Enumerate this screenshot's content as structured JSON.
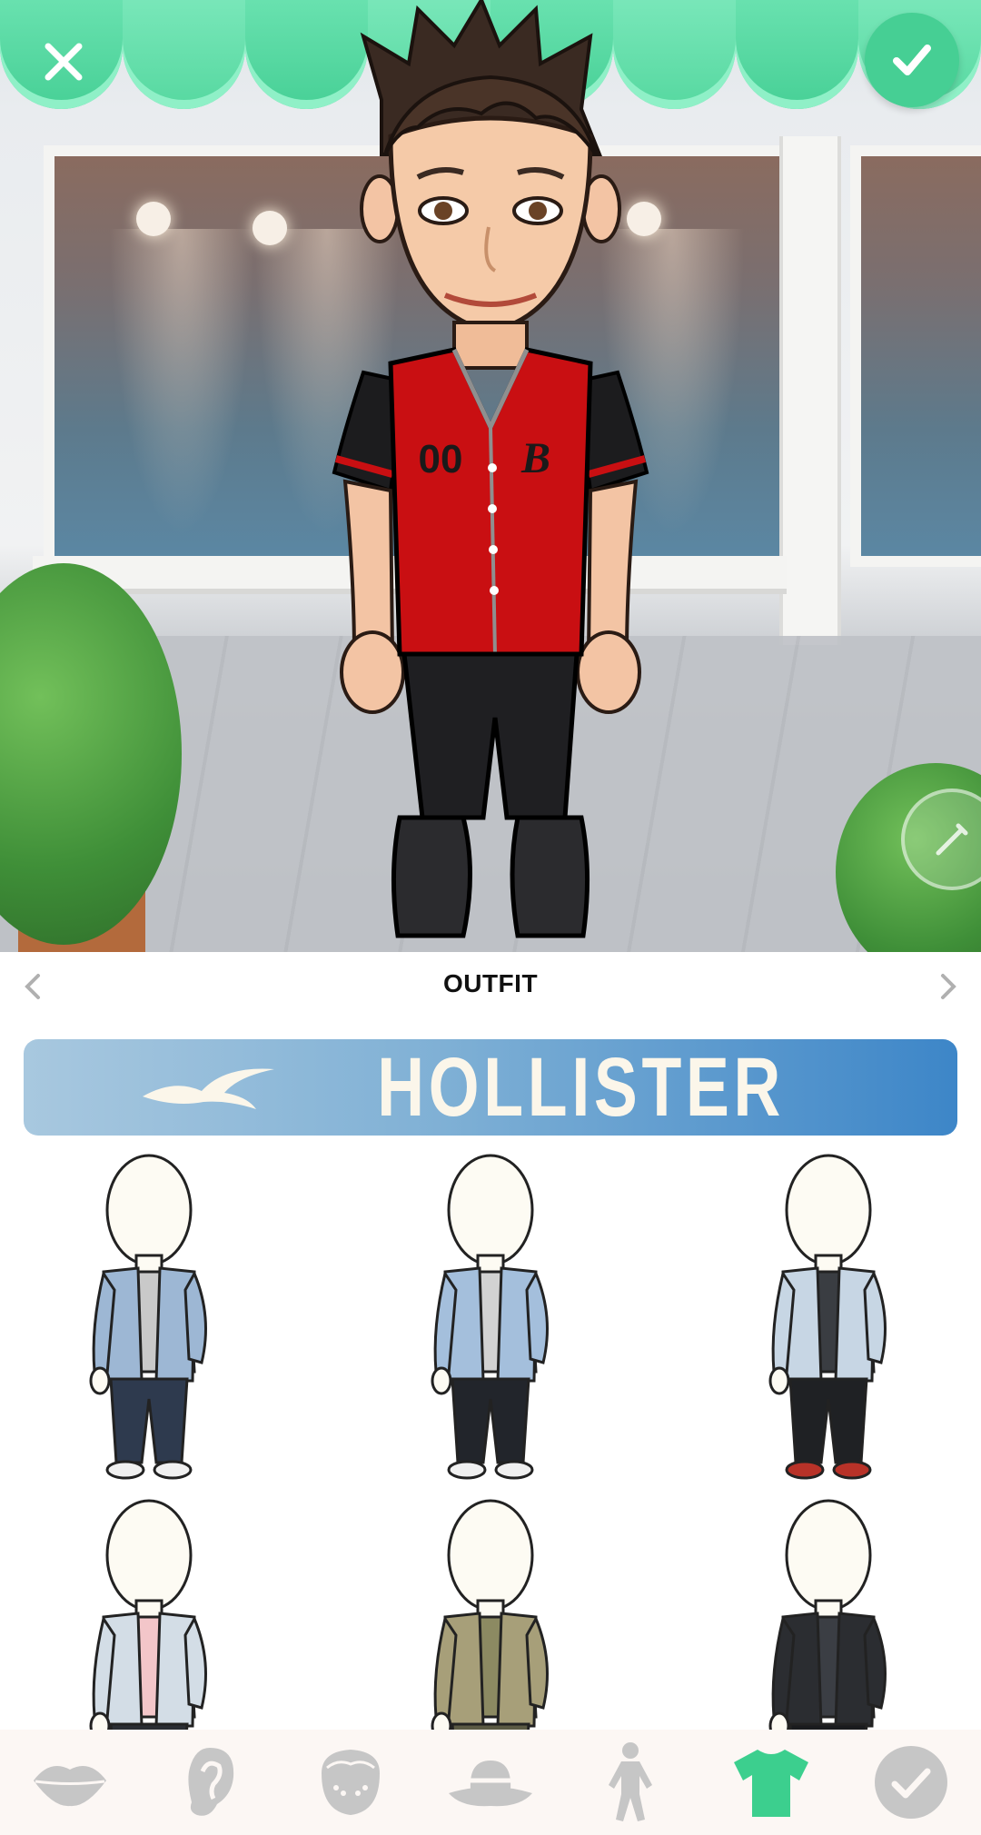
{
  "header": {
    "close_icon": "close-icon",
    "confirm_icon": "check-icon"
  },
  "preview": {
    "edit_icon": "pencil-icon",
    "jersey_number": "00",
    "jersey_letter": "B"
  },
  "panel": {
    "title": "OUTFIT",
    "prev_icon": "chevron-left-icon",
    "next_icon": "chevron-right-icon",
    "brand": "HOLLISTER",
    "brand_icon": "seagull-icon"
  },
  "outfits": [
    {
      "jacket": "#9db7d4",
      "shirt": "#c9c9c9",
      "pants": "#2e3a4e",
      "shoes": "#f0f0f0"
    },
    {
      "jacket": "#a4bfdc",
      "shirt": "#d2d2d2",
      "pants": "#22252b",
      "shoes": "#f0f0f0"
    },
    {
      "jacket": "#c7d6e4",
      "shirt": "#3a3d42",
      "pants": "#1f2124",
      "shoes": "#b83228"
    },
    {
      "jacket": "#d3dde6",
      "shirt": "#f3c6c9",
      "pants": "#2a2d33",
      "shoes": "#f0f0f0"
    },
    {
      "jacket": "#a79f79",
      "shirt": "#8c8a62",
      "pants": "#5b5a44",
      "shoes": "#f0f0f0"
    },
    {
      "jacket": "#2b2d31",
      "shirt": "#3b3e44",
      "pants": "#1a1b1e",
      "shoes": "#f0f0f0"
    }
  ],
  "tabs": [
    {
      "name": "tab-lips",
      "icon": "lips-icon"
    },
    {
      "name": "tab-ears",
      "icon": "ear-icon"
    },
    {
      "name": "tab-face-details",
      "icon": "face-icon"
    },
    {
      "name": "tab-hats",
      "icon": "hat-icon"
    },
    {
      "name": "tab-body",
      "icon": "body-icon"
    },
    {
      "name": "tab-outfit",
      "icon": "shirt-icon",
      "active": true
    },
    {
      "name": "tab-done",
      "icon": "check-circle-icon"
    }
  ],
  "colors": {
    "accent": "#46cf94",
    "tab_inactive": "#c6c6c6",
    "tab_active": "#3ccf8e",
    "jersey": "#c90f12"
  }
}
